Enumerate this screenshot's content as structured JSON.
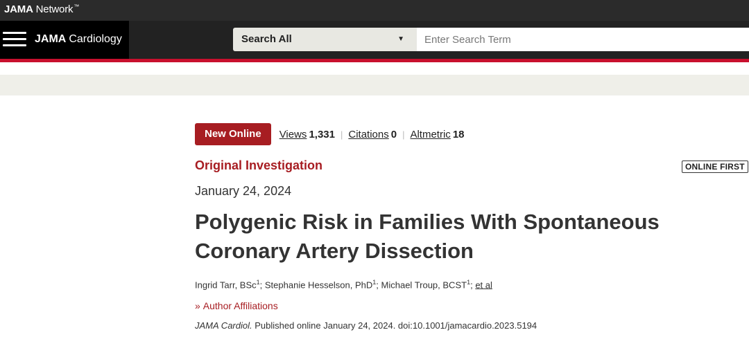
{
  "network": {
    "brand_bold": "JAMA",
    "brand_rest": " Network",
    "brand_tm": "™"
  },
  "journal": {
    "name_bold": "JAMA",
    "name_rest": "Cardiology"
  },
  "search": {
    "scope": "Search All",
    "placeholder": "Enter Search Term"
  },
  "metrics": {
    "badge": "New Online",
    "views_label": "Views",
    "views_value": "1,331",
    "citations_label": "Citations",
    "citations_value": "0",
    "altmetric_label": "Altmetric",
    "altmetric_value": "18",
    "separator": "|"
  },
  "article": {
    "type": "Original Investigation",
    "status_badge": "ONLINE FIRST",
    "date": "January 24, 2024",
    "title": "Polygenic Risk in Families With Spontaneous Coronary Artery Dissection"
  },
  "authors": [
    {
      "name": "Ingrid Tarr, BSc",
      "sup": "1"
    },
    {
      "name": "Stephanie Hesselson, PhD",
      "sup": "1"
    },
    {
      "name": "Michael Troup, BCST",
      "sup": "1"
    }
  ],
  "authors_more": "et al",
  "affiliations_label": "Author Affiliations",
  "citation": {
    "journal_abbr": "JAMA Cardiol.",
    "text": " Published online January 24, 2024. doi:10.1001/jamacardio.2023.5194"
  },
  "icons": {
    "menu": "hamburger-icon",
    "caret": "caret-down-icon",
    "chevron": "double-chevron-right-icon"
  },
  "colors": {
    "accent": "#a71d22",
    "topbar": "#2b2b2b",
    "navbar": "#222222",
    "redline": "#c8102e",
    "band": "#efefe9"
  }
}
